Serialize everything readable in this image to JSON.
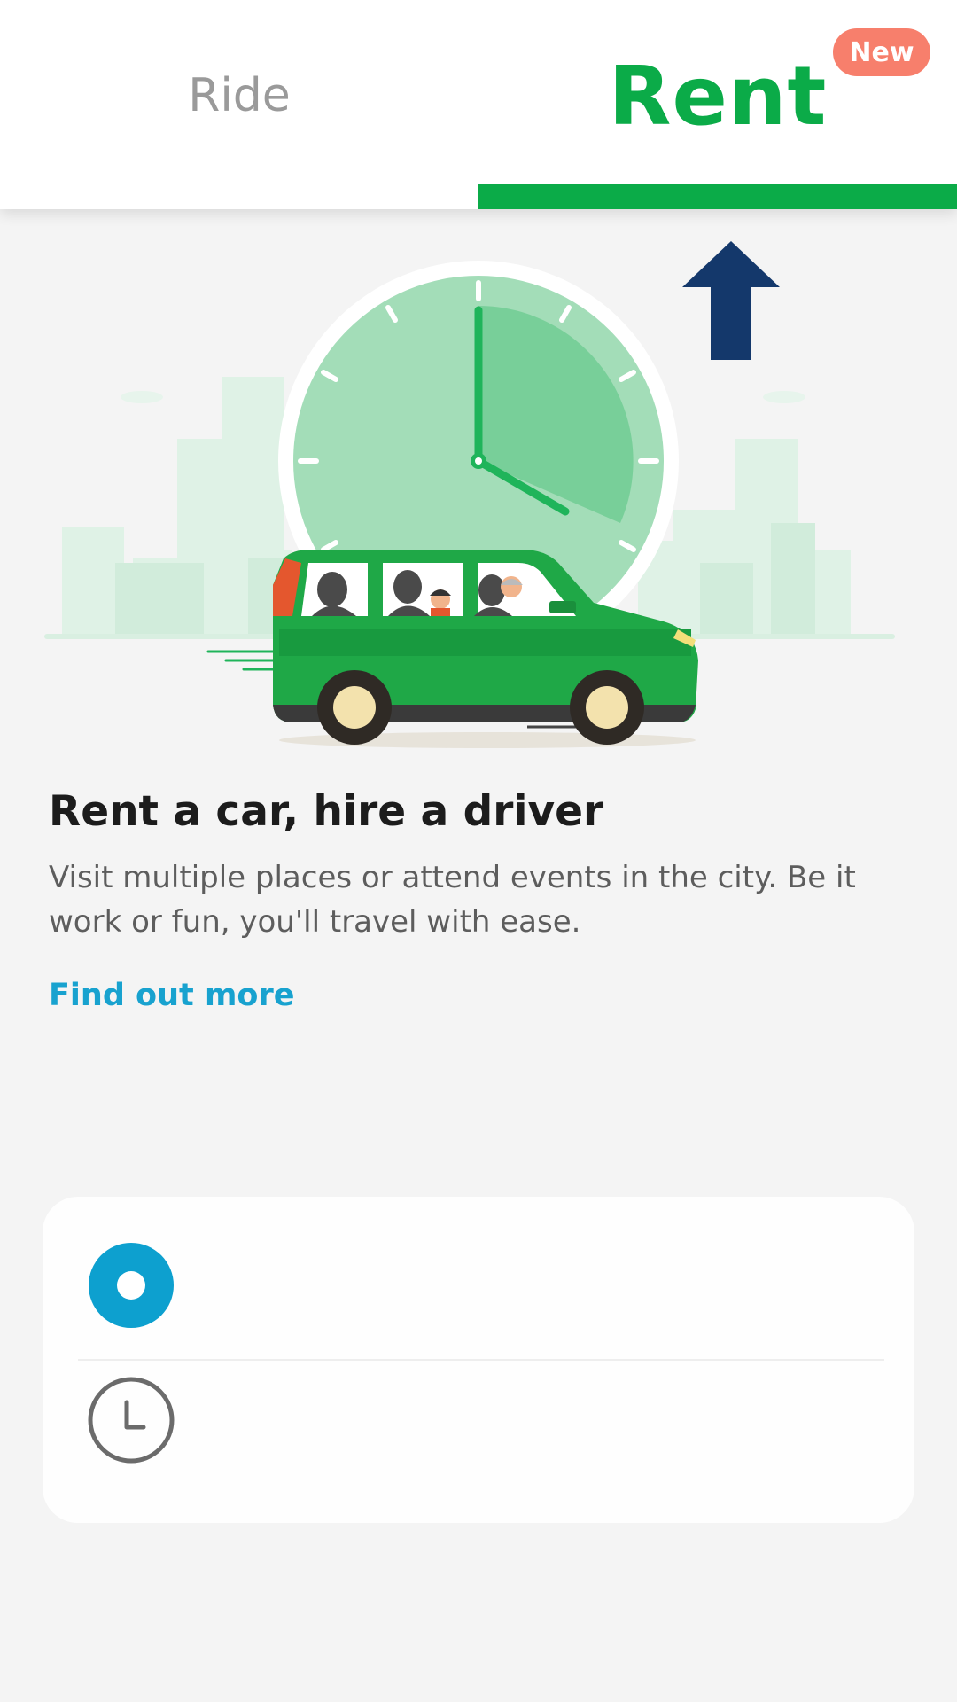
{
  "tabs": {
    "ride_label": "Ride",
    "rent_label": "Rent",
    "new_badge": "New",
    "active_color": "#0bab48",
    "inactive_color": "#9a9a9a"
  },
  "content": {
    "headline": "Rent a car, hire a driver",
    "description": "Visit multiple places or attend events in the city. Be it work or fun, you'll travel with ease.",
    "find_more_link": "Find out more",
    "link_color": "#18a2cf"
  },
  "location_card": {
    "pickup_icon": "pickup-location-icon",
    "schedule_icon": "clock-icon"
  }
}
